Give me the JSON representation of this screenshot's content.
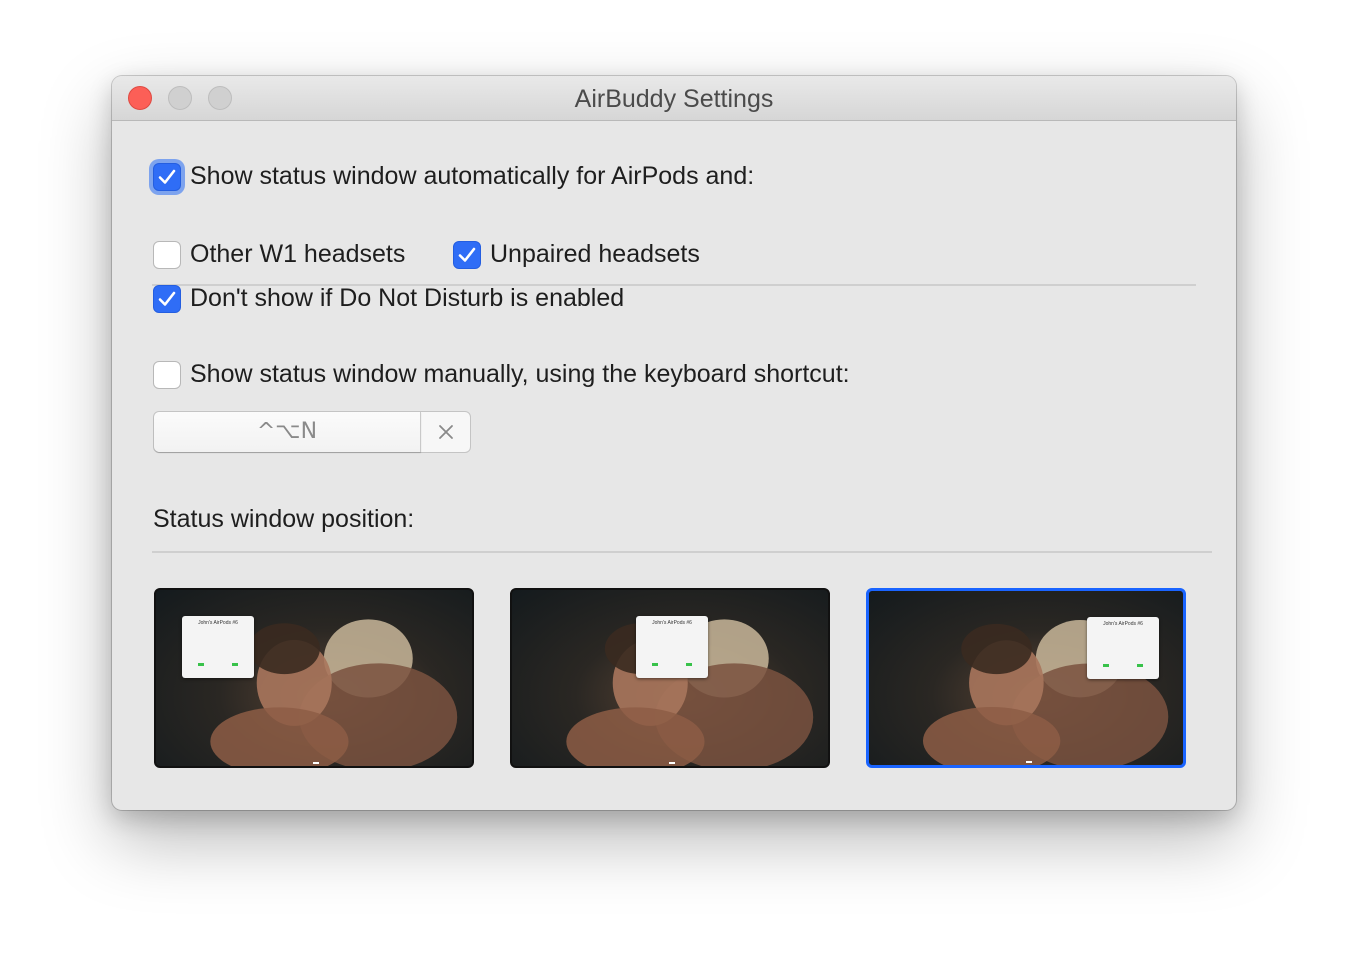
{
  "window": {
    "title": "AirBuddy Settings"
  },
  "auto": {
    "label": "Show status window automatically for AirPods and:",
    "checked": true
  },
  "options": {
    "other_w1": {
      "label": "Other W1 headsets",
      "checked": false
    },
    "unpaired": {
      "label": "Unpaired headsets",
      "checked": true
    },
    "dnd": {
      "label": "Don't show if Do Not Disturb is enabled",
      "checked": true
    }
  },
  "manual": {
    "label": "Show status window manually, using the keyboard shortcut:",
    "checked": false
  },
  "shortcut": {
    "value": "^⌥N"
  },
  "position": {
    "label": "Status window position:",
    "options": [
      {
        "name": "left",
        "popup_title": "John's AirPods #6",
        "selected": false
      },
      {
        "name": "center",
        "popup_title": "John's AirPods #6",
        "selected": false
      },
      {
        "name": "right",
        "popup_title": "John's AirPods #6",
        "selected": true
      }
    ]
  },
  "colors": {
    "accent": "#2f6df6",
    "selection_border": "#1a64ff",
    "close_button": "#fc5f57"
  }
}
